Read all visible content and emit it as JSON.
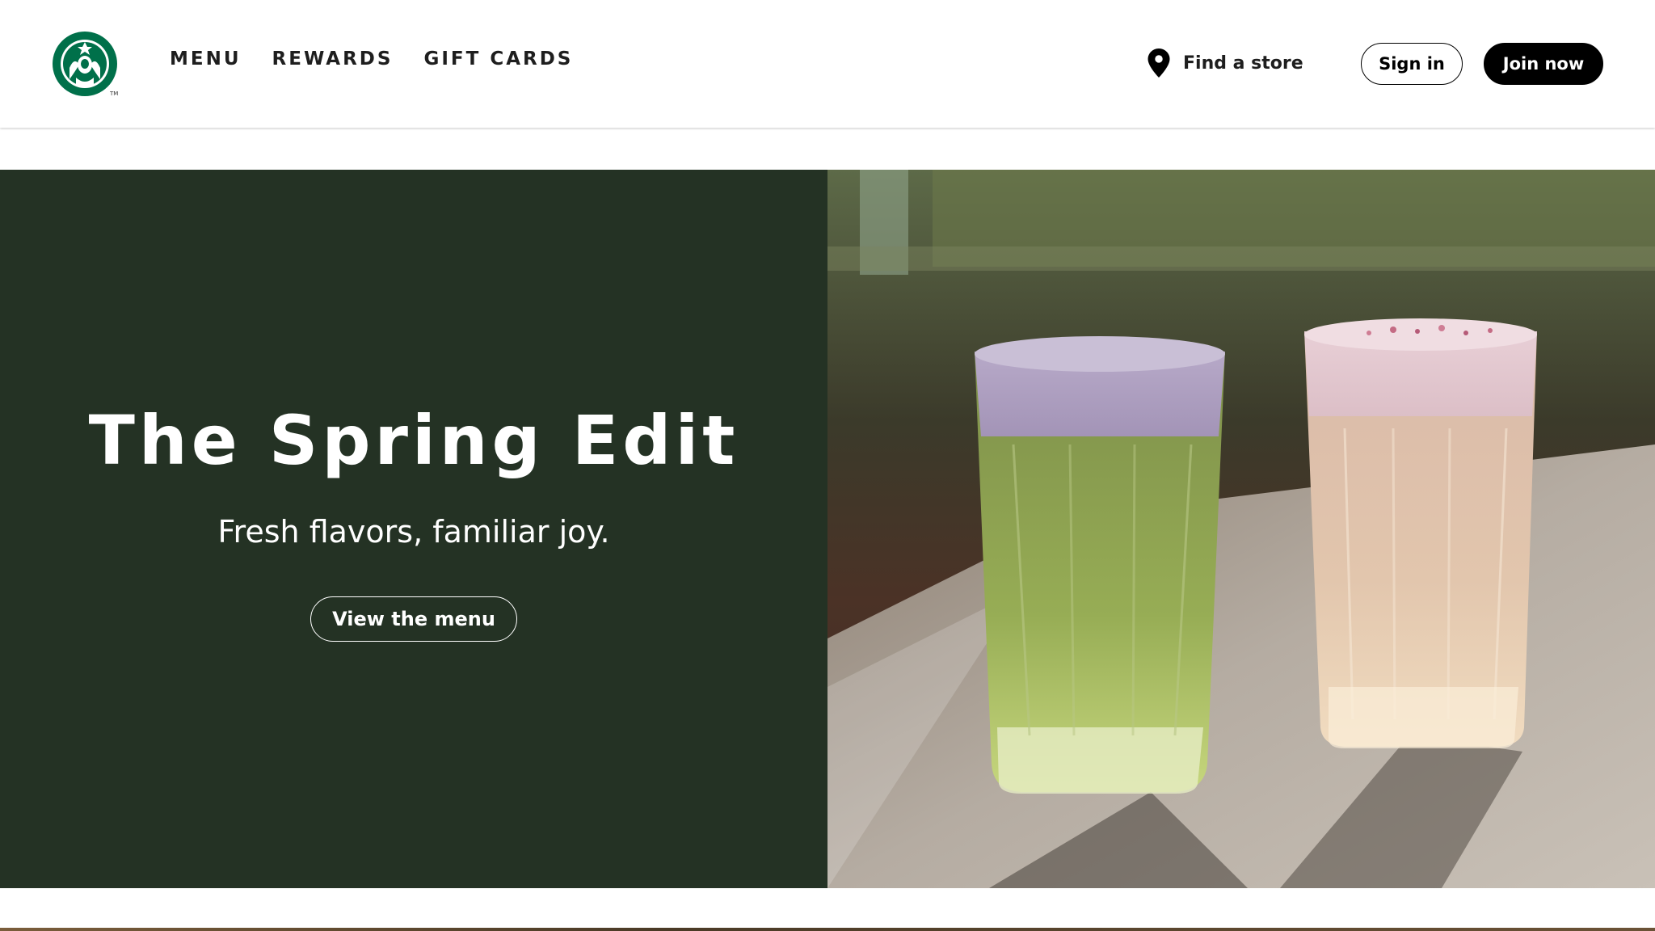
{
  "header": {
    "logo_icon": "starbucks-siren-logo",
    "nav": [
      {
        "label": "MENU"
      },
      {
        "label": "REWARDS"
      },
      {
        "label": "GIFT CARDS"
      }
    ],
    "find_store": {
      "label": "Find a store",
      "icon": "location-pin-icon"
    },
    "sign_in_label": "Sign in",
    "join_now_label": "Join now"
  },
  "hero": {
    "title": "The Spring Edit",
    "subtitle": "Fresh flavors, familiar joy.",
    "cta_label": "View the menu",
    "background_color": "#243224",
    "image_description_icon": "two-iced-drinks-image"
  },
  "colors": {
    "brand_green": "#006241",
    "hero_green": "#243224",
    "black": "#000000",
    "white": "#ffffff"
  }
}
